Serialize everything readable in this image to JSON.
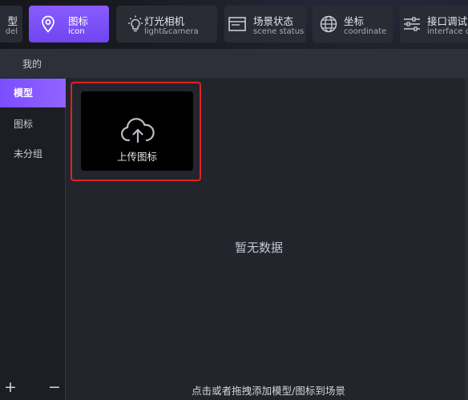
{
  "toolbar": {
    "items": [
      {
        "label": "型",
        "sublabel": "del"
      },
      {
        "label": "图标",
        "sublabel": "icon",
        "active": true
      },
      {
        "label": "灯光相机",
        "sublabel": "light&camera"
      },
      {
        "label": "场景状态",
        "sublabel": "scene status"
      },
      {
        "label": "坐标",
        "sublabel": "coordinate"
      },
      {
        "label": "接口调试",
        "sublabel": "interface d"
      }
    ],
    "icons": [
      "map-pin-icon",
      "lightbulb-icon",
      "window-icon",
      "globe-icon",
      "sliders-icon"
    ]
  },
  "subbar": {
    "tab_label": "我的"
  },
  "sidebar": {
    "items": [
      {
        "label": "模型",
        "active": true
      },
      {
        "label": "图标"
      },
      {
        "label": "未分组"
      }
    ],
    "add_label": "+",
    "remove_label": "−"
  },
  "main": {
    "upload_label": "上传图标",
    "empty_text": "暂无数据",
    "hint_text": "点击或者拖拽添加模型/图标到场景"
  },
  "colors": {
    "accent": "#7c4dff",
    "highlight_border": "#e0211f",
    "background": "#23252d"
  }
}
